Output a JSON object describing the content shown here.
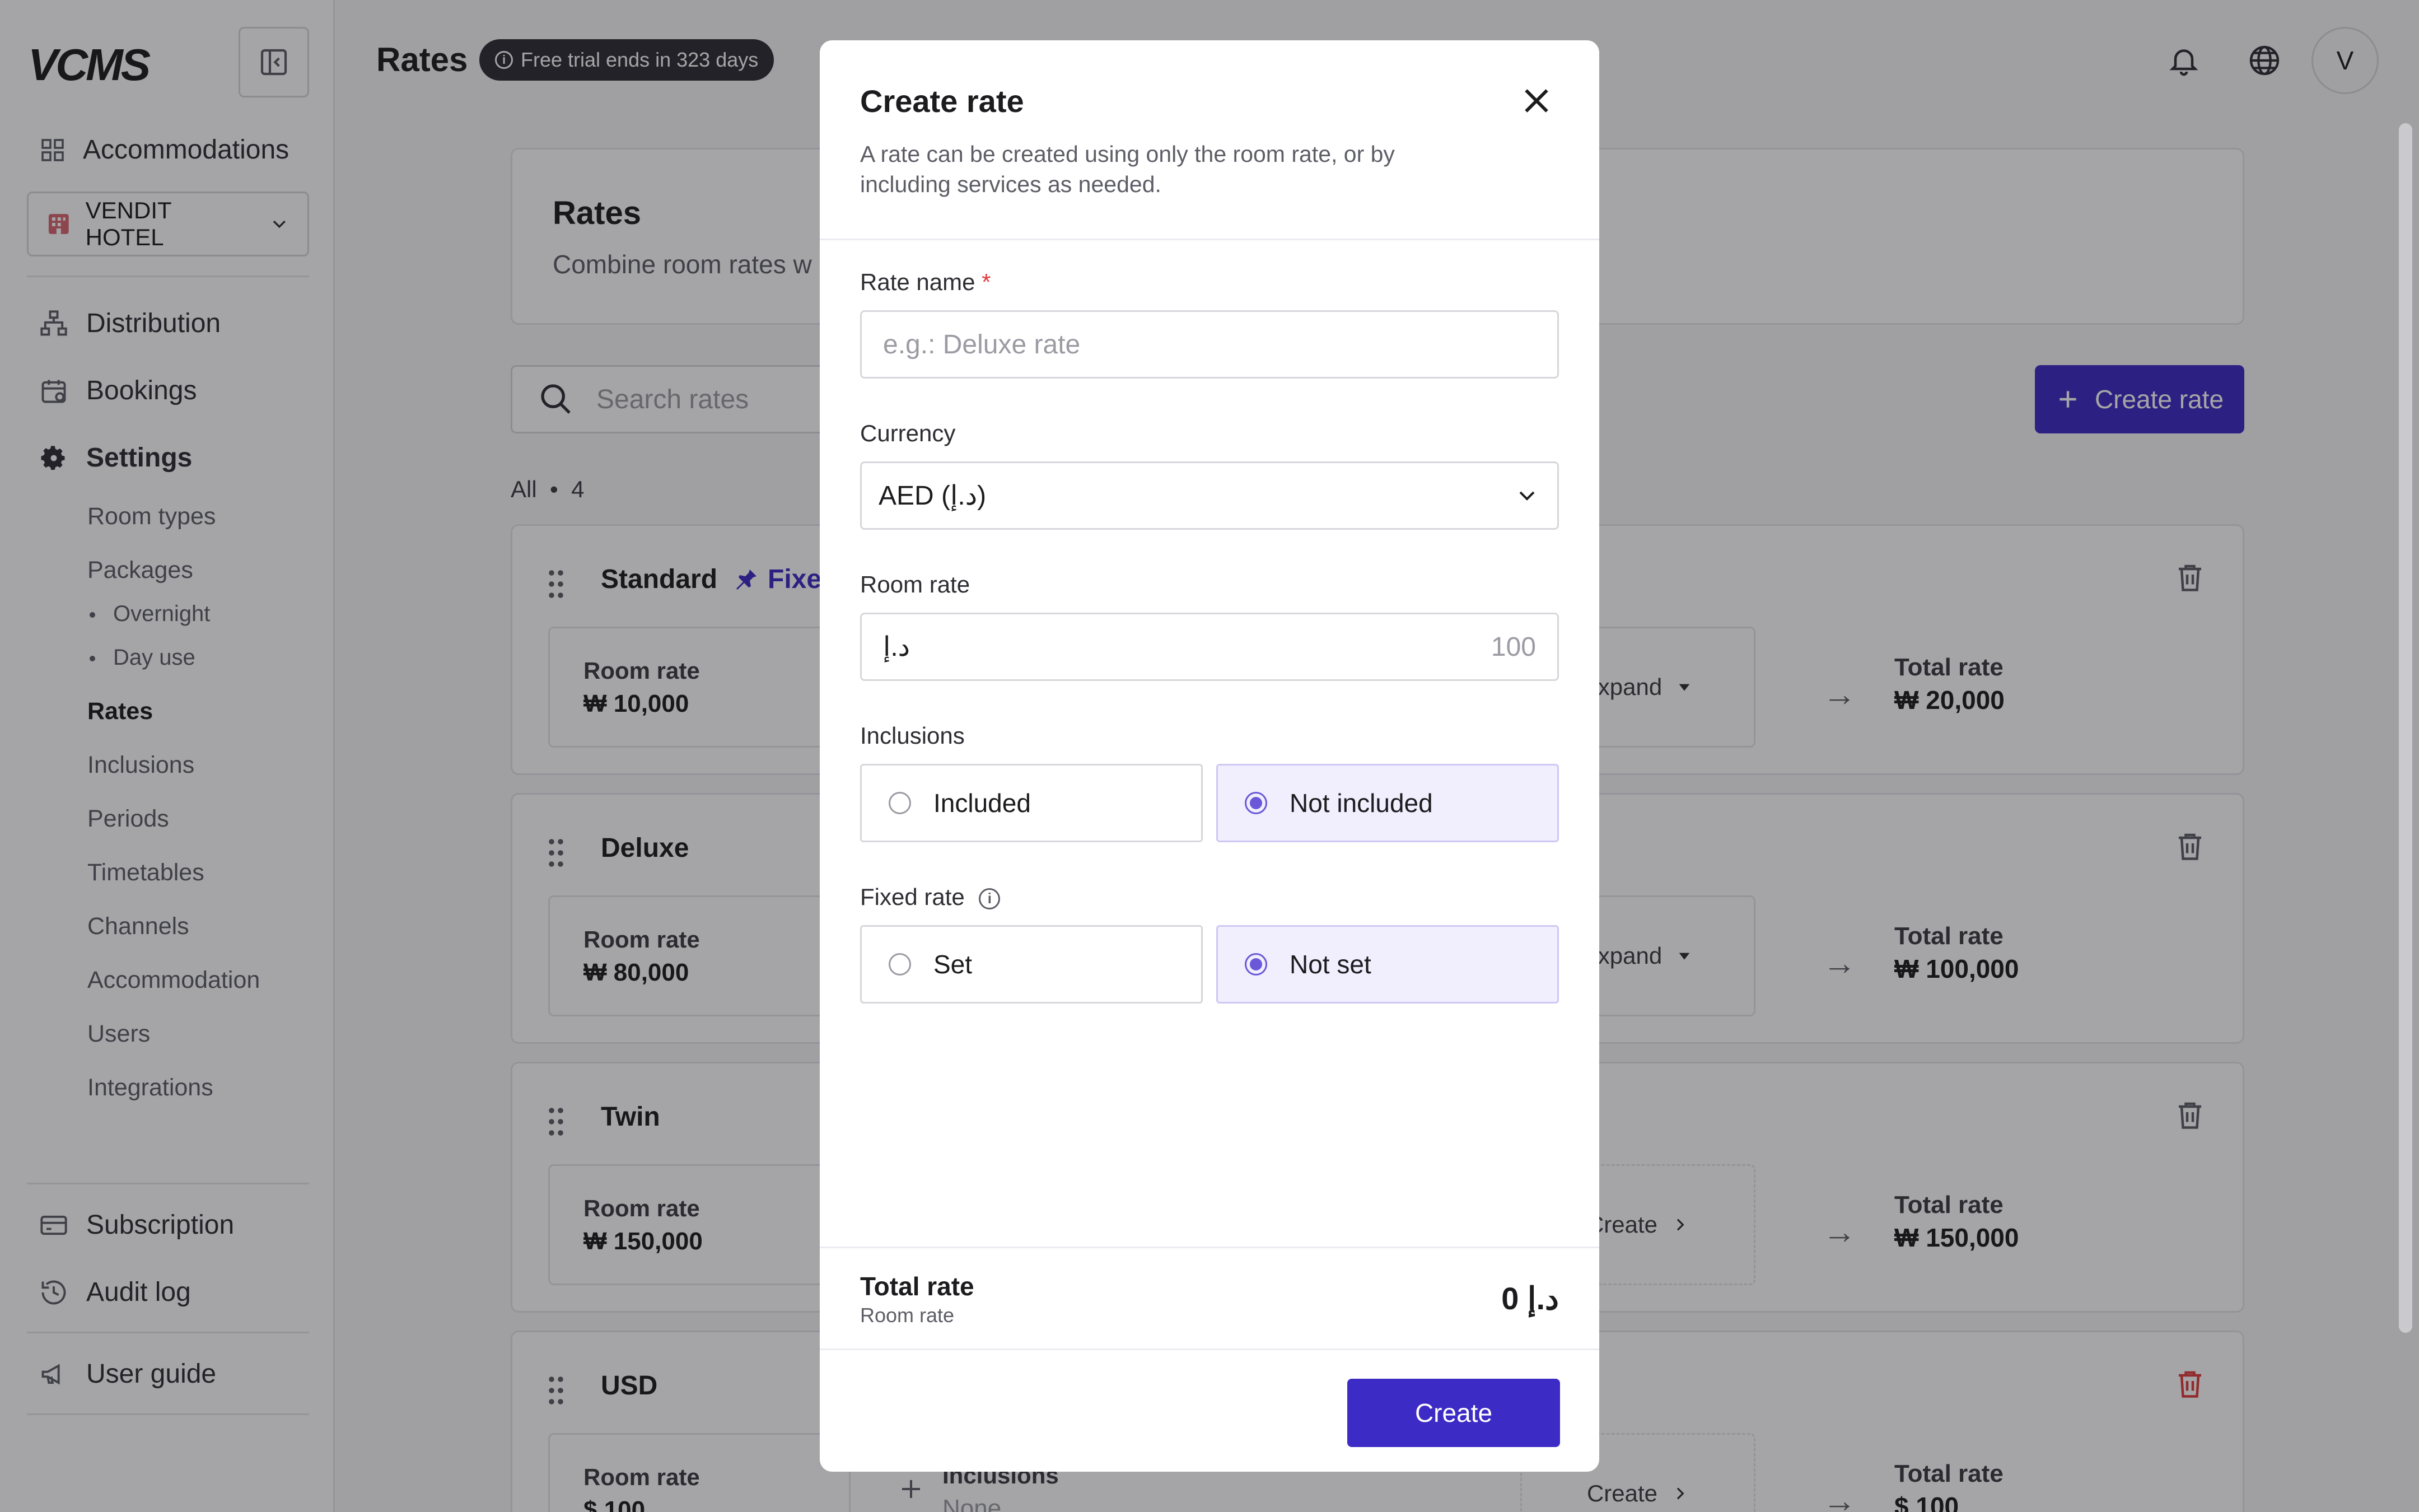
{
  "app": {
    "logo": "VCMS",
    "page_title": "Rates",
    "trial_badge": "Free trial ends in 323 days",
    "avatar_initial": "V"
  },
  "sidebar": {
    "accommodations": "Accommodations",
    "hotel": "VENDIT HOTEL",
    "main_items": [
      {
        "label": "Distribution",
        "icon": "sitemap-icon"
      },
      {
        "label": "Bookings",
        "icon": "calendar-check-icon"
      },
      {
        "label": "Settings",
        "icon": "gear-icon"
      }
    ],
    "settings_items": [
      "Room types",
      "Packages",
      "Rates",
      "Inclusions",
      "Periods",
      "Timetables",
      "Channels",
      "Accommodation",
      "Users",
      "Integrations"
    ],
    "package_items": [
      "Overnight",
      "Day use"
    ],
    "active_item": "Rates",
    "bottom_items": [
      {
        "label": "Subscription",
        "icon": "credit-card-icon"
      },
      {
        "label": "Audit log",
        "icon": "history-icon"
      },
      {
        "label": "User guide",
        "icon": "megaphone-icon"
      }
    ]
  },
  "main": {
    "intro_title": "Rates",
    "intro_desc": "Combine room rates w",
    "search_placeholder": "Search rates",
    "create_button": "Create rate",
    "count_label": "All",
    "count_value": "4",
    "rates": [
      {
        "name": "Standard",
        "tag": "Fixe",
        "room_rate_label": "Room rate",
        "room_rate": "₩ 10,000",
        "action": "Expand",
        "total_label": "Total rate",
        "total": "₩ 20,000"
      },
      {
        "name": "Deluxe",
        "tag": "",
        "room_rate_label": "Room rate",
        "room_rate": "₩ 80,000",
        "action": "Expand",
        "total_label": "Total rate",
        "total": "₩ 100,000"
      },
      {
        "name": "Twin",
        "tag": "",
        "room_rate_label": "Room rate",
        "room_rate": "₩ 150,000",
        "action": "Create",
        "total_label": "Total rate",
        "total": "₩ 150,000"
      },
      {
        "name": "USD",
        "tag": "",
        "room_rate_label": "Room rate",
        "room_rate": "$ 100",
        "inclusions_label": "Inclusions",
        "inclusions_value": "None",
        "action": "Create",
        "total_label": "Total rate",
        "total": "$ 100"
      }
    ]
  },
  "modal": {
    "title": "Create rate",
    "description": "A rate can be created using only the room rate, or by including services as needed.",
    "rate_name_label": "Rate name",
    "required_mark": "*",
    "rate_name_placeholder": "e.g.: Deluxe rate",
    "currency_label": "Currency",
    "currency_value": "AED (د.إ)",
    "room_rate_label": "Room rate",
    "room_rate_prefix": "د.إ",
    "room_rate_placeholder": "100",
    "inclusions_label": "Inclusions",
    "inclusions_options": [
      "Included",
      "Not included"
    ],
    "inclusions_selected": "Not included",
    "fixed_rate_label": "Fixed rate",
    "fixed_rate_options": [
      "Set",
      "Not set"
    ],
    "fixed_rate_selected": "Not set",
    "total_label": "Total rate",
    "total_sub": "Room rate",
    "total_value": "د.إ 0",
    "create_button": "Create"
  },
  "colors": {
    "primary": "#3c2bc4",
    "selected_bg": "#f1eefe",
    "danger": "#e03a3a"
  }
}
